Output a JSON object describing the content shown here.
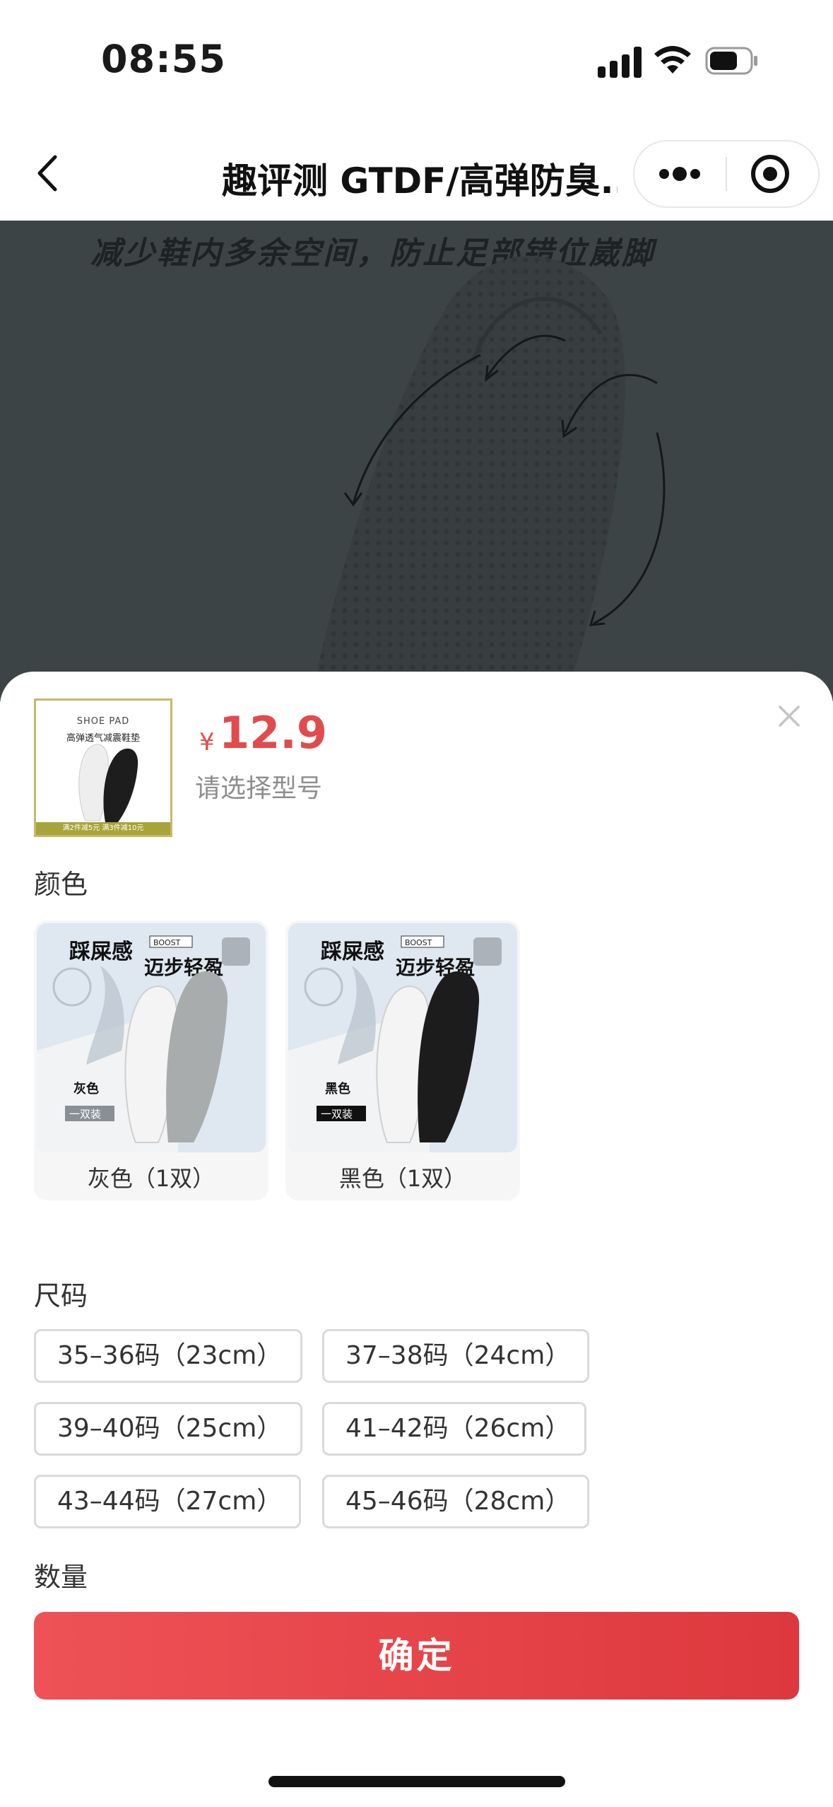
{
  "status_bar": {
    "time": "08:55"
  },
  "nav": {
    "title": "趣评测 GTDF/高弹防臭..."
  },
  "background": {
    "caption": "减少鞋内多余空间，防止足部错位崴脚"
  },
  "product": {
    "thumb_brand": "SHOE PAD",
    "thumb_title": "高弹透气减震鞋垫",
    "thumb_promo": "满2件减5元 满3件减10元",
    "currency": "¥",
    "price": "12.9",
    "select_hint": "请选择型号"
  },
  "color_section": {
    "label": "颜色",
    "options": [
      {
        "label": "灰色（1双）",
        "img_headline": "踩屎感",
        "img_sub": "迈步轻盈",
        "img_badge": "BOOST",
        "img_color": "灰色",
        "img_pack": "一双装",
        "insole_color": "#a9acad"
      },
      {
        "label": "黑色（1双）",
        "img_headline": "踩屎感",
        "img_sub": "迈步轻盈",
        "img_badge": "BOOST",
        "img_color": "黑色",
        "img_pack": "一双装",
        "insole_color": "#1c1c1c"
      }
    ]
  },
  "size_section": {
    "label": "尺码",
    "options": [
      "35–36码（23cm）",
      "37–38码（24cm）",
      "39–40码（25cm）",
      "41–42码（26cm）",
      "43–44码（27cm）",
      "45–46码（28cm）"
    ]
  },
  "quantity_section": {
    "label": "数量"
  },
  "confirm": {
    "label": "确定"
  },
  "colors": {
    "accent": "#e14b4d",
    "button": "#e8464a"
  }
}
